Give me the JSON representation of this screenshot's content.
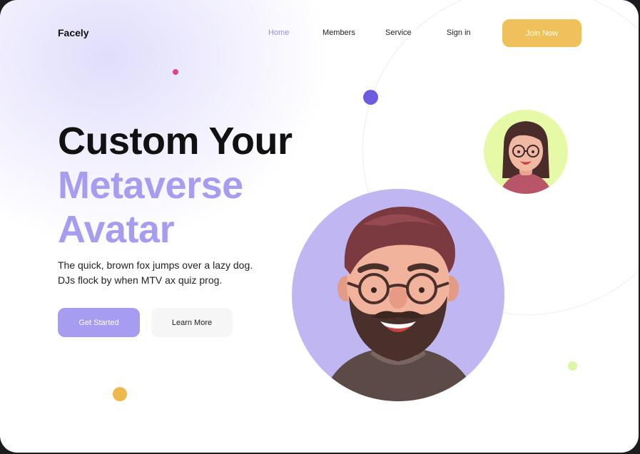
{
  "brand": {
    "name": "Facely"
  },
  "nav": {
    "items": [
      {
        "label": "Home",
        "active": true
      },
      {
        "label": "Members",
        "active": false
      },
      {
        "label": "Service",
        "active": false
      },
      {
        "label": "Sign in",
        "active": false
      }
    ],
    "cta_label": "Join Now"
  },
  "hero": {
    "title_line1": "Custom Your",
    "title_line2": "Metaverse",
    "title_line3": "Avatar",
    "subtitle_line1": "The quick, brown fox jumps over a lazy dog.",
    "subtitle_line2": "DJs flock by when MTV ax quiz prog.",
    "primary_button": "Get Started",
    "secondary_button": "Learn More"
  },
  "colors": {
    "accent": "#a69cf0",
    "nav_active": "#9b8ee8",
    "cta": "#eec15a",
    "dot_pink": "#e0457b",
    "dot_purple": "#6c5ce0",
    "dot_yellow": "#eeb94c",
    "dot_lime": "#dcf5a6",
    "avatar_big_bg": "#bfb6f2",
    "avatar_small_bg": "#e6f9a7"
  },
  "icons": {
    "avatar_large": "bearded-man-avatar",
    "avatar_small": "girl-with-glasses-avatar"
  }
}
